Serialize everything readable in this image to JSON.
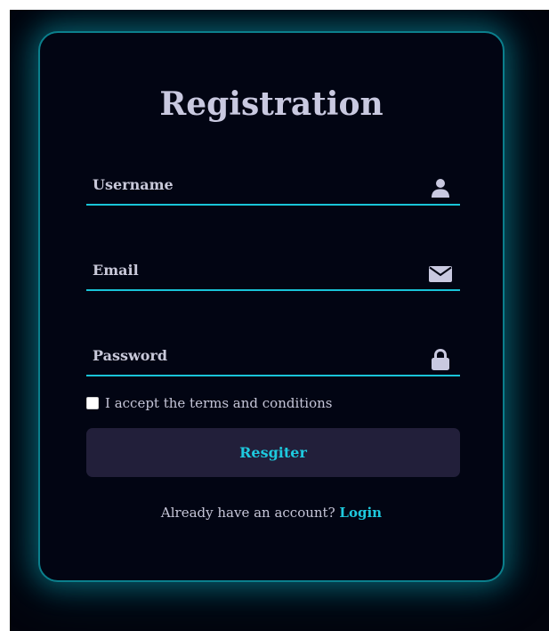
{
  "form": {
    "title": "Registration",
    "fields": [
      {
        "placeholder": "Username",
        "icon": "user-icon"
      },
      {
        "placeholder": "Email",
        "icon": "envelope-icon"
      },
      {
        "placeholder": "Password",
        "icon": "lock-icon"
      }
    ],
    "terms_label": "I accept the terms and conditions",
    "register_label": "Resgiter",
    "login_prompt": "Already have an account?",
    "login_link": "Login"
  },
  "colors": {
    "accent": "#19c4d8",
    "background": "#02040d",
    "button_bg": "#221f3a",
    "text": "#c9c9e0"
  }
}
